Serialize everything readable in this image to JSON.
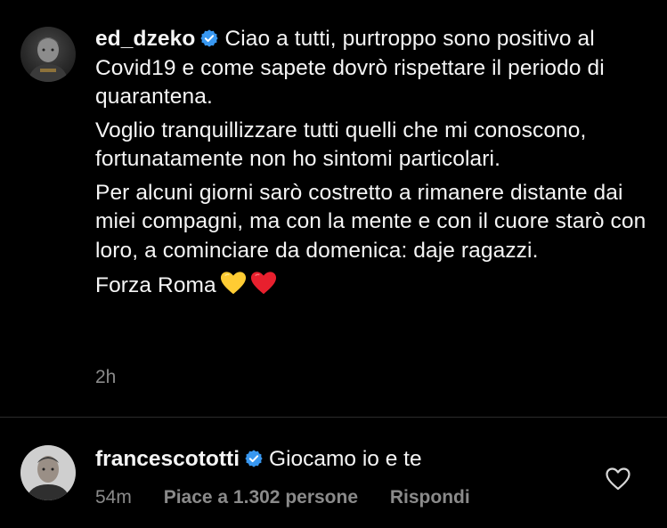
{
  "caption": {
    "username": "ed_dzeko",
    "verified": true,
    "paragraphs": [
      "Ciao a tutti, purtroppo sono positivo al Covid19 e come sapete dovrò rispettare il periodo di quarantena.",
      "Voglio tranquillizzare tutti quelli che mi conoscono, fortunatamente non ho sintomi particolari.",
      "Per alcuni giorni sarò costretto a rimanere distante dai miei compagni, ma con la mente e con il cuore starò con loro, a cominciare da domenica: daje ragazzi.",
      "Forza Roma"
    ],
    "emojis": [
      "yellow-heart-icon",
      "red-heart-icon"
    ],
    "timestamp": "2h"
  },
  "reply": {
    "username": "francescototti",
    "verified": true,
    "text": "Giocamo io e te",
    "timestamp": "54m",
    "likes_label": "Piace a 1.302 persone",
    "reply_label": "Rispondi"
  },
  "colors": {
    "background": "#000000",
    "text": "#f5f5f5",
    "muted": "#8a8a8a",
    "verified": "#3897f0",
    "yellow_heart": "#ffcc33",
    "red_heart": "#e8202e"
  }
}
